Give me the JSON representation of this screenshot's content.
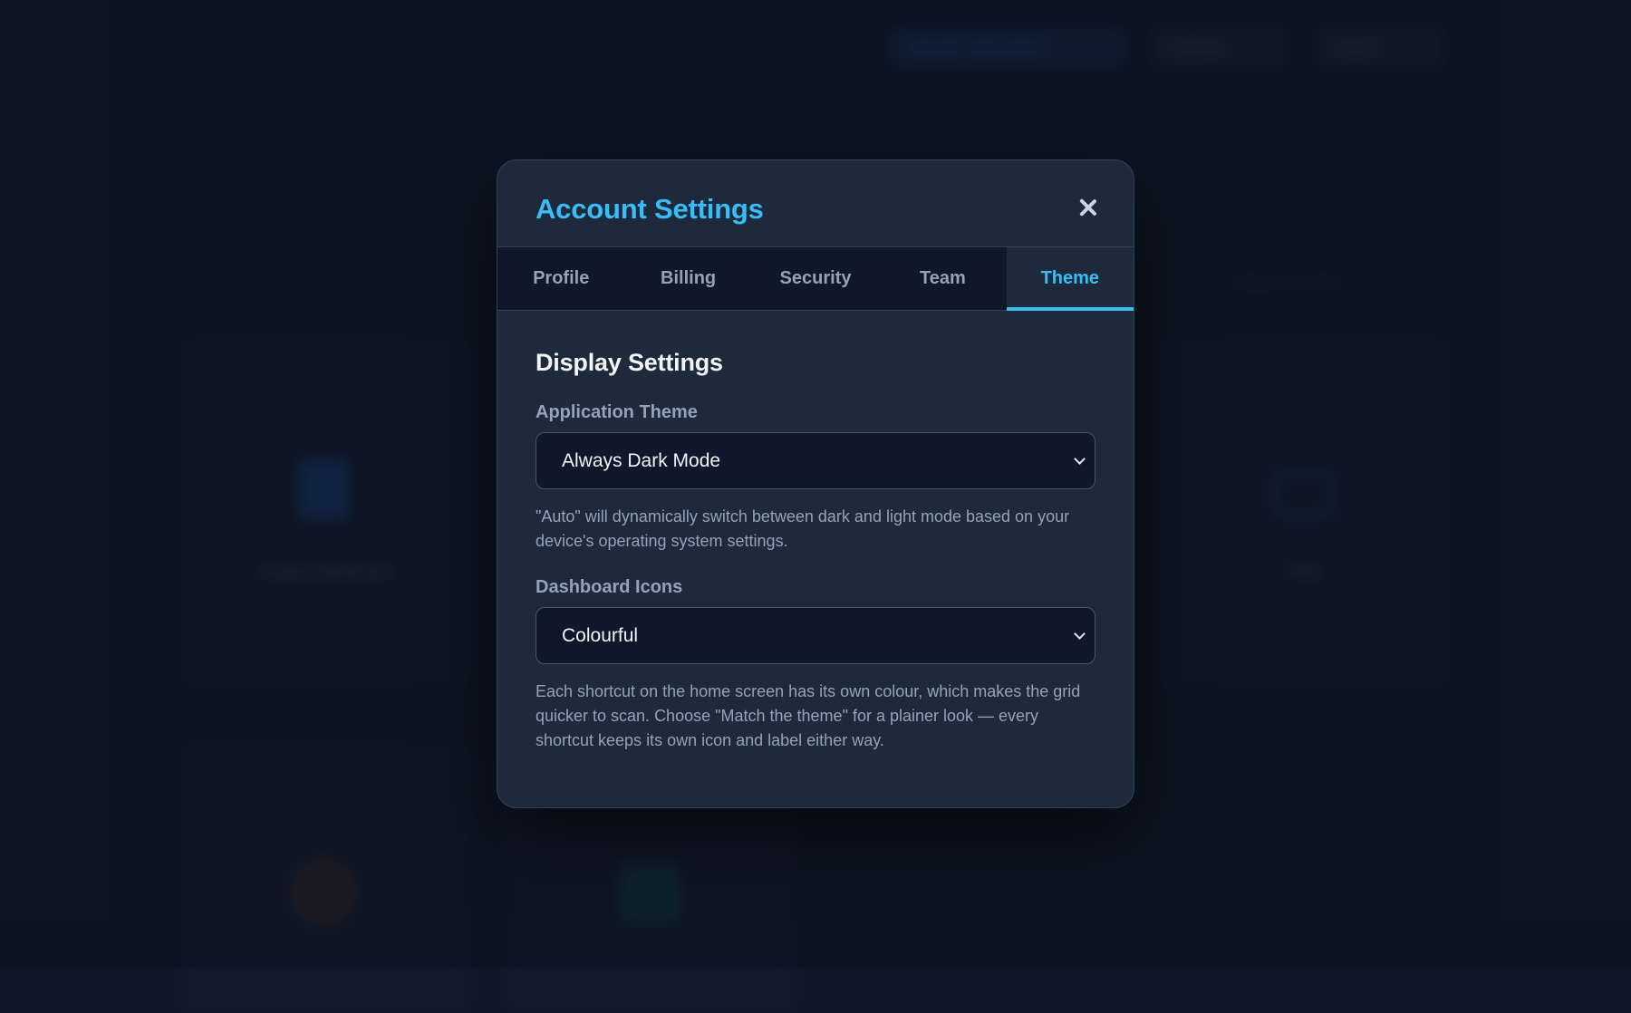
{
  "background": {
    "top_buttons": [
      "Upgrade Subscription",
      "Settings",
      "Logout"
    ],
    "top_link": "Expand All Tiles",
    "tiles": [
      "Usage Dashboard",
      "Files"
    ]
  },
  "modal": {
    "title": "Account Settings",
    "tabs": [
      {
        "label": "Profile",
        "active": false
      },
      {
        "label": "Billing",
        "active": false
      },
      {
        "label": "Security",
        "active": false
      },
      {
        "label": "Team",
        "active": false
      },
      {
        "label": "Theme",
        "active": true
      }
    ],
    "section_title": "Display Settings",
    "theme_field": {
      "label": "Application Theme",
      "value": "Always Dark Mode",
      "help": "\"Auto\" will dynamically switch between dark and light mode based on your device's operating system settings."
    },
    "icons_field": {
      "label": "Dashboard Icons",
      "value": "Colourful",
      "help": "Each shortcut on the home screen has its own colour, which makes the grid quicker to scan. Choose \"Match the theme\" for a plainer look — every shortcut keeps its own icon and label either way."
    }
  },
  "colors": {
    "accent": "#38bdf8",
    "modal_bg": "#1e293b",
    "page_bg": "#0f1729"
  }
}
